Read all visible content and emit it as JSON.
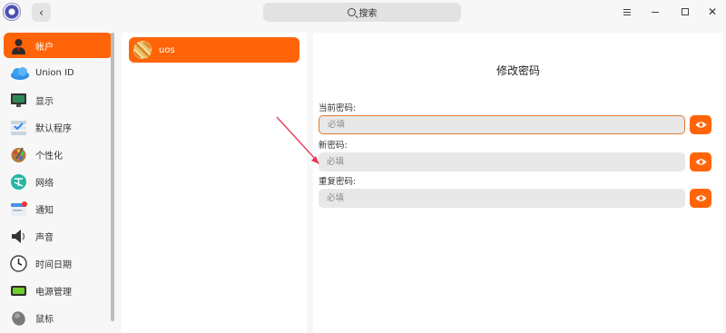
{
  "titlebar": {
    "search_placeholder": "搜索",
    "back_icon": "chevron-left-icon",
    "window_controls": [
      "menu-icon",
      "minimize-icon",
      "maximize-icon",
      "close-icon"
    ]
  },
  "sidebar": {
    "items": [
      {
        "label": "帐户",
        "icon": "user-icon",
        "active": true
      },
      {
        "label": "Union ID",
        "icon": "cloud-icon",
        "active": false
      },
      {
        "label": "显示",
        "icon": "monitor-icon",
        "active": false
      },
      {
        "label": "默认程序",
        "icon": "default-apps-icon",
        "active": false
      },
      {
        "label": "个性化",
        "icon": "palette-icon",
        "active": false
      },
      {
        "label": "网络",
        "icon": "network-icon",
        "active": false
      },
      {
        "label": "通知",
        "icon": "notification-icon",
        "active": false
      },
      {
        "label": "声音",
        "icon": "speaker-icon",
        "active": false
      },
      {
        "label": "时间日期",
        "icon": "clock-icon",
        "active": false
      },
      {
        "label": "电源管理",
        "icon": "battery-icon",
        "active": false
      },
      {
        "label": "鼠标",
        "icon": "mouse-icon",
        "active": false
      }
    ]
  },
  "accounts": {
    "items": [
      {
        "name": "uos",
        "selected": true
      }
    ]
  },
  "form": {
    "title": "修改密码",
    "fields": [
      {
        "label": "当前密码:",
        "placeholder": "必填",
        "value": ""
      },
      {
        "label": "新密码:",
        "placeholder": "必填",
        "value": ""
      },
      {
        "label": "重复密码:",
        "placeholder": "必填",
        "value": ""
      }
    ]
  },
  "colors": {
    "accent": "#ff6508",
    "annotation_arrow": "#e8365a"
  }
}
